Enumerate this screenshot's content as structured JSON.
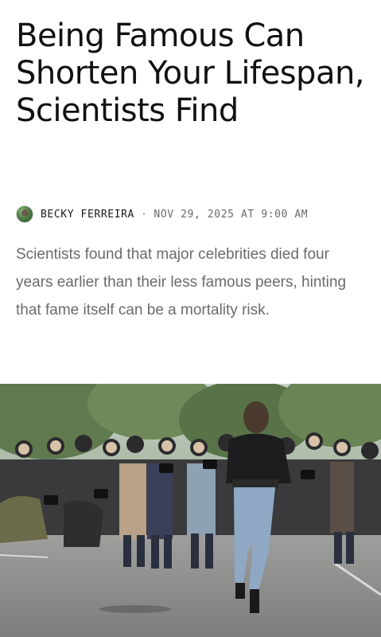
{
  "article": {
    "headline": "Being Famous Can Shorten Your Lifespan, Scientists Find",
    "author": "BECKY FERREIRA",
    "separator": "·",
    "date": "NOV 29, 2025 AT 9:00 AM",
    "dek": "Scientists found that major celebrities died four years earlier than their less famous peers, hinting that fame itself can be a mortality risk."
  },
  "hero_image": {
    "icon": "photo-icon",
    "subject": "woman walking toward a crowd of photographers"
  },
  "colors": {
    "headline": "#111111",
    "dek": "#6b6b6b",
    "byline_date": "#6a6a6a",
    "background": "#ffffff"
  }
}
